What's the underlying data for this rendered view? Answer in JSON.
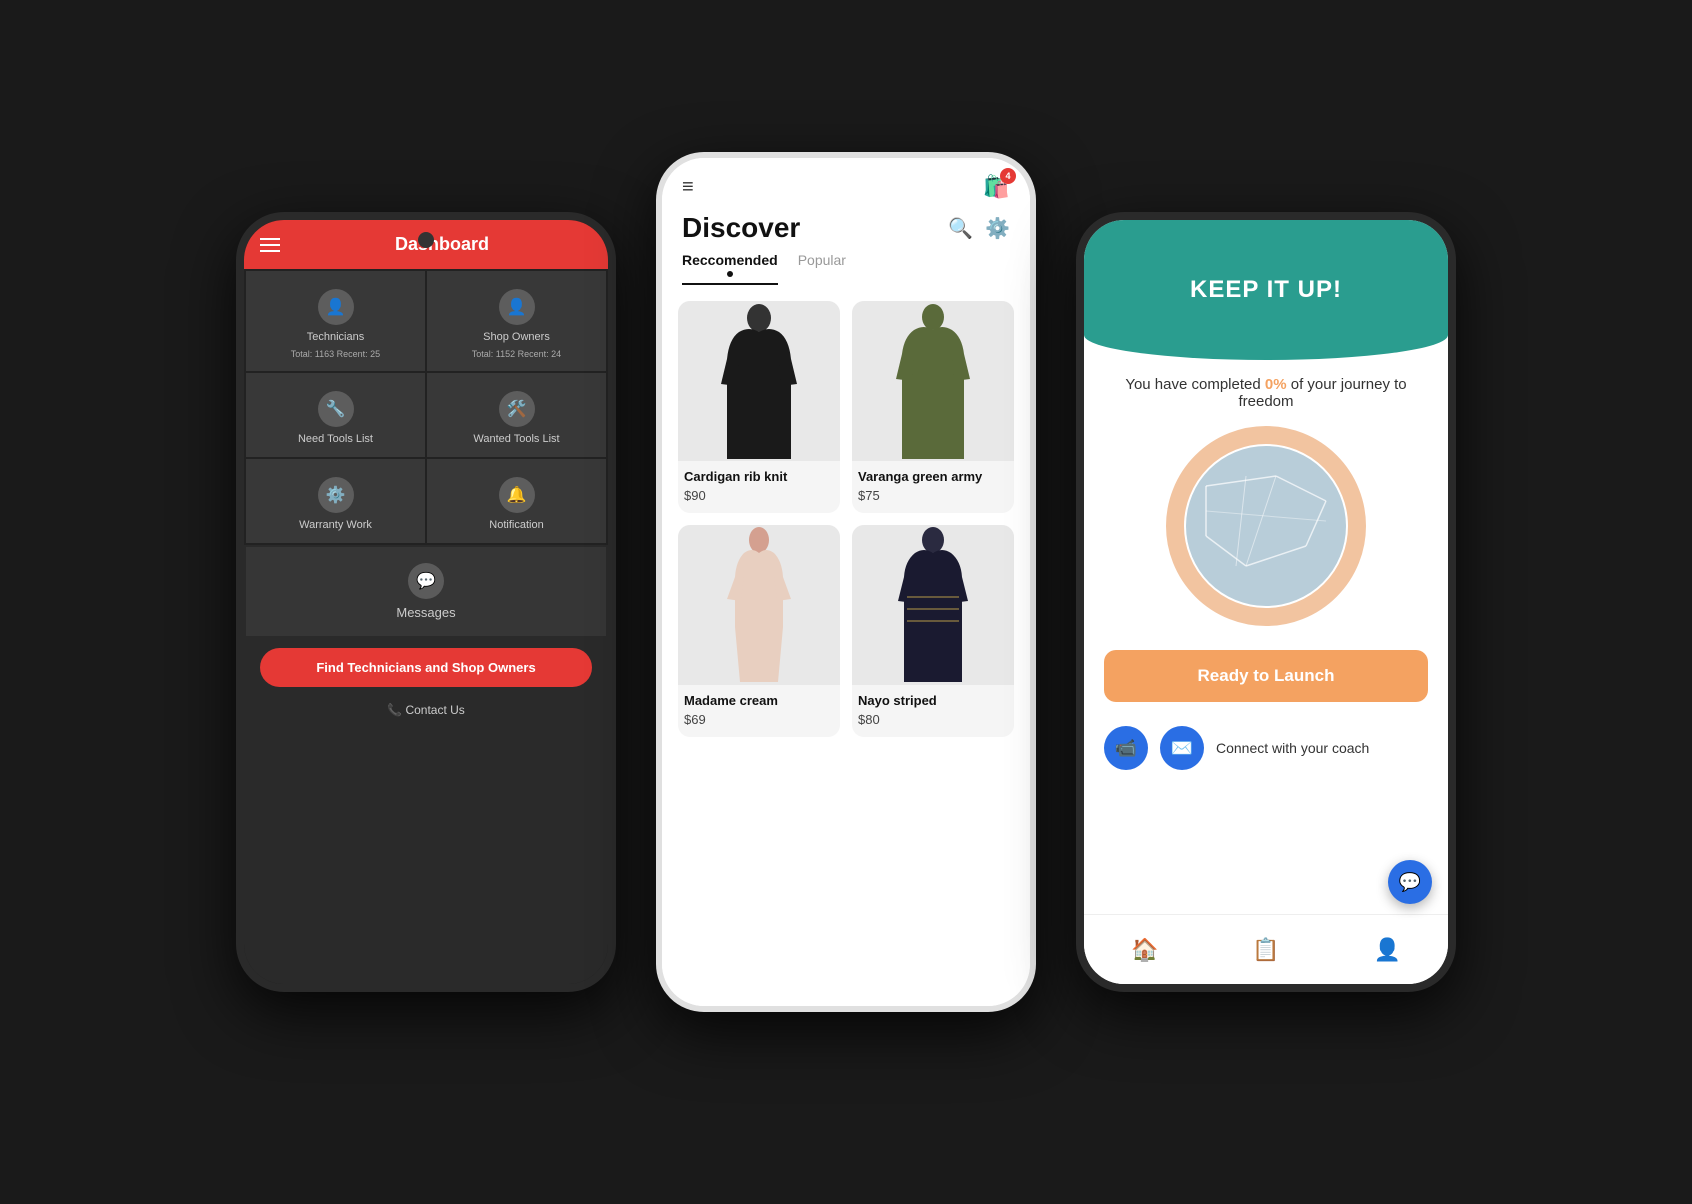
{
  "phone1": {
    "header": {
      "title": "Dashboard"
    },
    "grid": [
      {
        "label": "Technicians",
        "meta": "Total: 1163  Recent: 25"
      },
      {
        "label": "Shop Owners",
        "meta": "Total: 1152  Recent: 24"
      },
      {
        "label": "Need Tools List",
        "meta": ""
      },
      {
        "label": "Wanted Tools List",
        "meta": ""
      },
      {
        "label": "Warranty Work",
        "meta": ""
      },
      {
        "label": "Notification",
        "meta": ""
      }
    ],
    "messages_label": "Messages",
    "find_btn": "Find Technicians and Shop Owners",
    "contact": "Contact Us"
  },
  "phone2": {
    "cart_badge": "4",
    "page_title": "Discover",
    "tabs": [
      {
        "label": "Reccomended",
        "active": true
      },
      {
        "label": "Popular",
        "active": false
      }
    ],
    "products": [
      {
        "name": "Cardigan rib knit",
        "price": "$90",
        "color": "#222222"
      },
      {
        "name": "Varanga green army",
        "price": "$75",
        "color": "#5a6a3a"
      },
      {
        "name": "Madame cream",
        "price": "$69",
        "color": "#e8d5c0"
      },
      {
        "name": "Nayo striped",
        "price": "$80",
        "color": "#1a1a2e"
      }
    ]
  },
  "phone3": {
    "header_title": "KEEP IT UP!",
    "journey_text": "You have completed",
    "percent": "0%",
    "journey_suffix": "of your journey to freedom",
    "launch_btn": "Ready to Launch",
    "connect_text": "Connect with your coach",
    "nav_items": [
      "home",
      "list",
      "person"
    ]
  }
}
